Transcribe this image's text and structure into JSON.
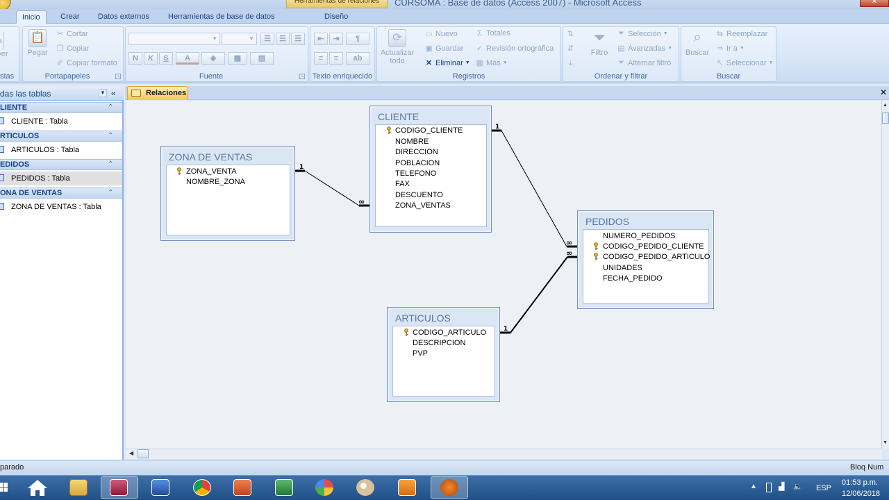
{
  "window": {
    "title": "CURSOMA : Base de datos (Access 2007) - Microsoft Access",
    "context_tab": "Herramientas de relaciones",
    "close_glyph": "✕"
  },
  "ribbon_tabs": [
    "Inicio",
    "Crear",
    "Datos externos",
    "Herramientas de base de datos",
    "Diseño"
  ],
  "ribbon": {
    "vistas": {
      "label": "stas",
      "btn": "ver"
    },
    "portapapeles": {
      "label": "Portapapeles",
      "pegar": "Pegar",
      "cortar": "Cortar",
      "copiar": "Copiar",
      "copiar_formato": "Copiar formato"
    },
    "fuente": {
      "label": "Fuente",
      "bold": "N",
      "italic": "K",
      "underline": "S",
      "font_color": "A"
    },
    "texto_enriquecido": {
      "label": "Texto enriquecido"
    },
    "registros": {
      "label": "Registros",
      "actualizar": "Actualizar",
      "actualizar2": "todo",
      "nuevo": "Nuevo",
      "guardar": "Guardar",
      "eliminar": "Eliminar",
      "totales": "Totales",
      "revision": "Revisión ortográfica",
      "mas": "Más"
    },
    "ordenar": {
      "label": "Ordenar y filtrar",
      "filtro": "Filtro",
      "seleccion": "Selección",
      "avanzadas": "Avanzadas",
      "alternar": "Alternar filtro"
    },
    "buscar": {
      "label": "Buscar",
      "buscar": "Buscar",
      "reemplazar": "Reemplazar",
      "ir_a": "Ir a",
      "seleccionar": "Seleccionar"
    }
  },
  "nav_pane": {
    "header": "das las tablas",
    "groups": [
      {
        "name": "LIENTE",
        "item": "CLIENTE : Tabla"
      },
      {
        "name": "RTICULOS",
        "item": "ARTICULOS : Tabla"
      },
      {
        "name": "EDIDOS",
        "item": "PEDIDOS : Tabla"
      },
      {
        "name": "ONA DE VENTAS",
        "item": "ZONA DE VENTAS : Tabla"
      }
    ]
  },
  "doc_tab": "Relaciones",
  "tables": {
    "zona": {
      "title": "ZONA DE VENTAS",
      "fields": [
        "ZONA_VENTA",
        "NOMBRE_ZONA"
      ]
    },
    "cliente": {
      "title": "CLIENTE",
      "fields": [
        "CODIGO_CLIENTE",
        "NOMBRE",
        "DIRECCION",
        "POBLACION",
        "TELEFONO",
        "FAX",
        "DESCUENTO",
        "ZONA_VENTAS"
      ]
    },
    "pedidos": {
      "title": "PEDIDOS",
      "fields": [
        "NUMERO_PEDIDOS",
        "CODIGO_PEDIDO_CLIENTE",
        "CODIGO_PEDIDO_ARTICULO",
        "UNIDADES",
        "FECHA_PEDIDO"
      ]
    },
    "articulos": {
      "title": "ARTICULOS",
      "fields": [
        "CODIGO_ARTICULO",
        "DESCRIPCION",
        "PVP"
      ]
    }
  },
  "relations": {
    "one": "1",
    "many": "∞"
  },
  "status": {
    "left": "parado",
    "right": "Bloq Num"
  },
  "taskbar": {
    "lang": "ESP",
    "time": "01:53 p.m.",
    "date": "12/06/2018"
  },
  "colors": {
    "accent": "#15428b",
    "ribbon": "#dfe8f5",
    "doctab": "#f6c75a",
    "taskbar": "#2a5a94"
  }
}
